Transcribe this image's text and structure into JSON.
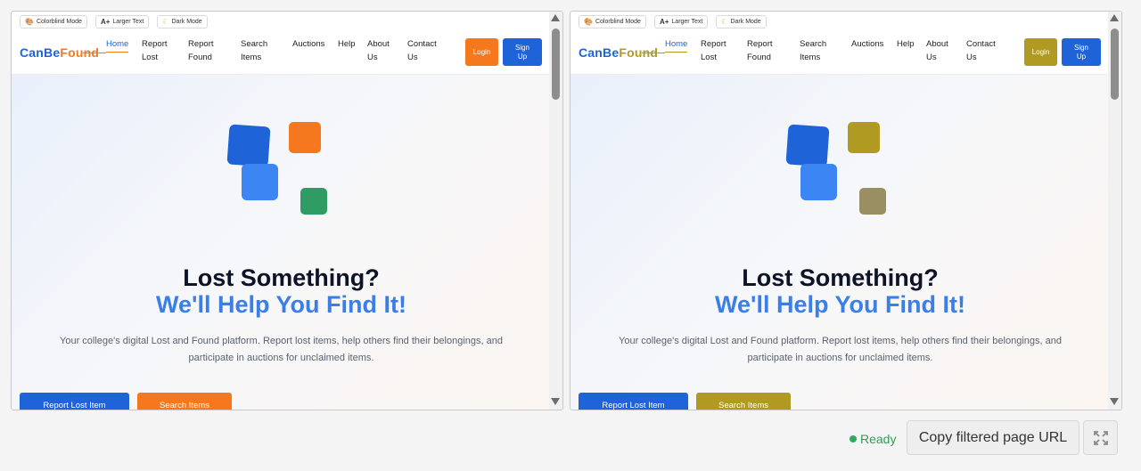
{
  "panes": [
    {
      "toolbar": {
        "colorblind": "Colorblind Mode",
        "larger_text": "Larger Text",
        "larger_text_icon": "A+",
        "dark_mode": "Dark Mode"
      },
      "nav": {
        "logo_part1": "CanBe",
        "logo_part2": "Found",
        "links": [
          {
            "line1": "Home",
            "line2": ""
          },
          {
            "line1": "Report",
            "line2": "Lost"
          },
          {
            "line1": "Report",
            "line2": "Found"
          },
          {
            "line1": "Search",
            "line2": "Items"
          },
          {
            "line1": "Auctions",
            "line2": ""
          },
          {
            "line1": "Help",
            "line2": ""
          },
          {
            "line1": "About",
            "line2": "Us"
          },
          {
            "line1": "Contact",
            "line2": "Us"
          }
        ],
        "login": "Login",
        "signup_l1": "Sign",
        "signup_l2": "Up"
      },
      "hero": {
        "title": "Lost Something?",
        "subtitle": "We'll Help You Find It!",
        "description_l1": "Your college's digital Lost and Found platform. Report lost items, help others find their belongings, and",
        "description_l2": "participate in auctions for unclaimed items.",
        "cta_lost": "Report Lost Item",
        "cta_search": "Search Items"
      }
    },
    {
      "toolbar": {
        "colorblind": "Colorblind Mode",
        "larger_text": "Larger Text",
        "larger_text_icon": "A+",
        "dark_mode": "Dark Mode"
      },
      "nav": {
        "logo_part1": "CanBe",
        "logo_part2": "Found",
        "links": [
          {
            "line1": "Home",
            "line2": ""
          },
          {
            "line1": "Report",
            "line2": "Lost"
          },
          {
            "line1": "Report",
            "line2": "Found"
          },
          {
            "line1": "Search",
            "line2": "Items"
          },
          {
            "line1": "Auctions",
            "line2": ""
          },
          {
            "line1": "Help",
            "line2": ""
          },
          {
            "line1": "About",
            "line2": "Us"
          },
          {
            "line1": "Contact",
            "line2": "Us"
          }
        ],
        "login": "Login",
        "signup_l1": "Sign",
        "signup_l2": "Up"
      },
      "hero": {
        "title": "Lost Something?",
        "subtitle": "We'll Help You Find It!",
        "description_l1": "Your college's digital Lost and Found platform. Report lost items, help others find their belongings, and",
        "description_l2": "participate in auctions for unclaimed items.",
        "cta_lost": "Report Lost Item",
        "cta_search": "Search Items"
      }
    }
  ],
  "colors": {
    "original_accent": "#f5781f",
    "original_secondary": "#2f9d63",
    "filtered_accent": "#b09a22",
    "filtered_secondary": "#9a8e63",
    "brand_blue": "#1e63d8"
  },
  "footer": {
    "status": "Ready",
    "copy_button": "Copy filtered page URL",
    "fullscreen_icon": "expand-icon"
  }
}
